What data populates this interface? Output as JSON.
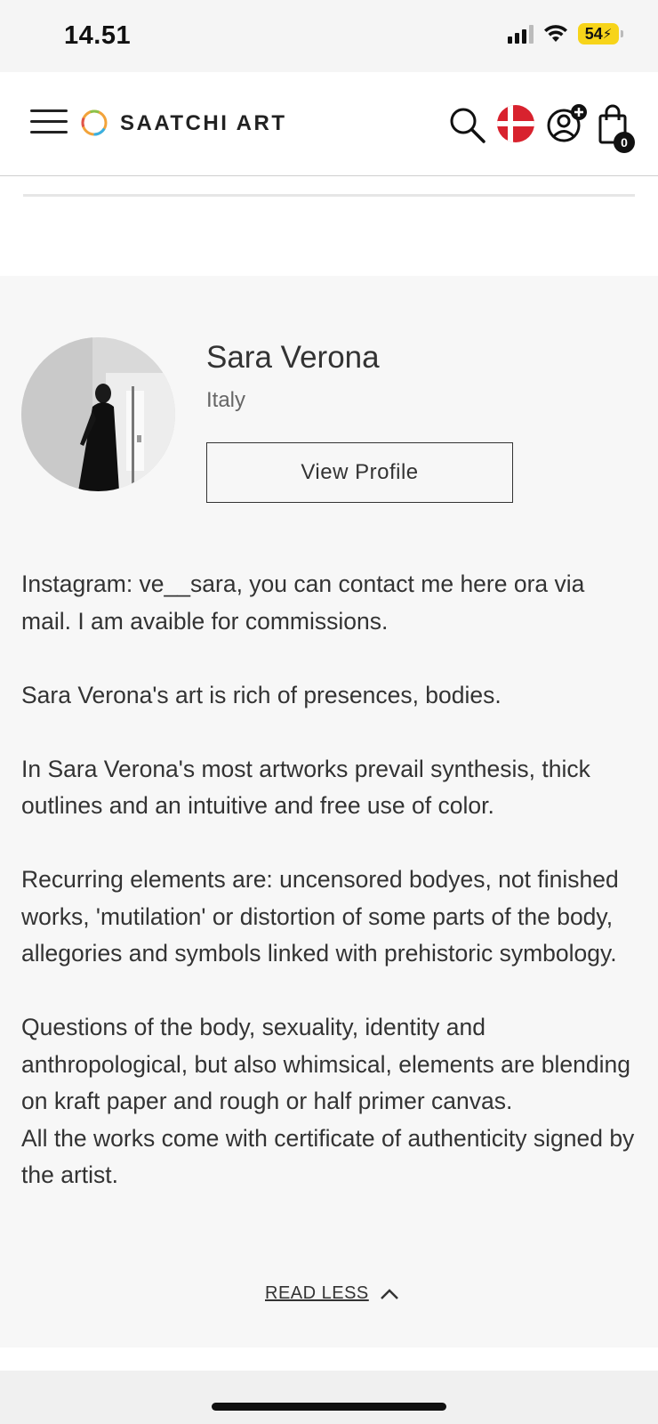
{
  "status_bar": {
    "time": "14.51",
    "battery": "54"
  },
  "header": {
    "logo_text": "SAATCHI ART",
    "cart_count": "0",
    "icons": [
      "menu-icon",
      "logo-icon",
      "search-icon",
      "denmark-flag-icon",
      "account-icon",
      "cart-icon"
    ]
  },
  "artist": {
    "name": "Sara Verona",
    "country": "Italy",
    "view_profile_label": "View Profile"
  },
  "bio": {
    "paragraphs": [
      "Instagram: ve__sara, you can contact me here ora via mail. I am avaible for commissions.",
      "Sara Verona's art is rich of presences, bodies.",
      "In Sara Verona's most artworks prevail synthesis, thick outlines and an intuitive and free use of color.",
      "Recurring elements are: uncensored bodyes, not finished works, 'mutilation' or distortion of some parts of the body, allegories and symbols linked with prehistoric symbology.",
      "Questions of the body, sexuality, identity and anthropological, but also whimsical, elements are blending on kraft paper and rough or half primer canvas.",
      "All the works come with certificate of authenticity signed by the artist."
    ],
    "read_less_label": "READ LESS"
  },
  "colors": {
    "brand_text": "#222222",
    "flag_red": "#d8222e",
    "battery_fill": "#f7d41a"
  }
}
